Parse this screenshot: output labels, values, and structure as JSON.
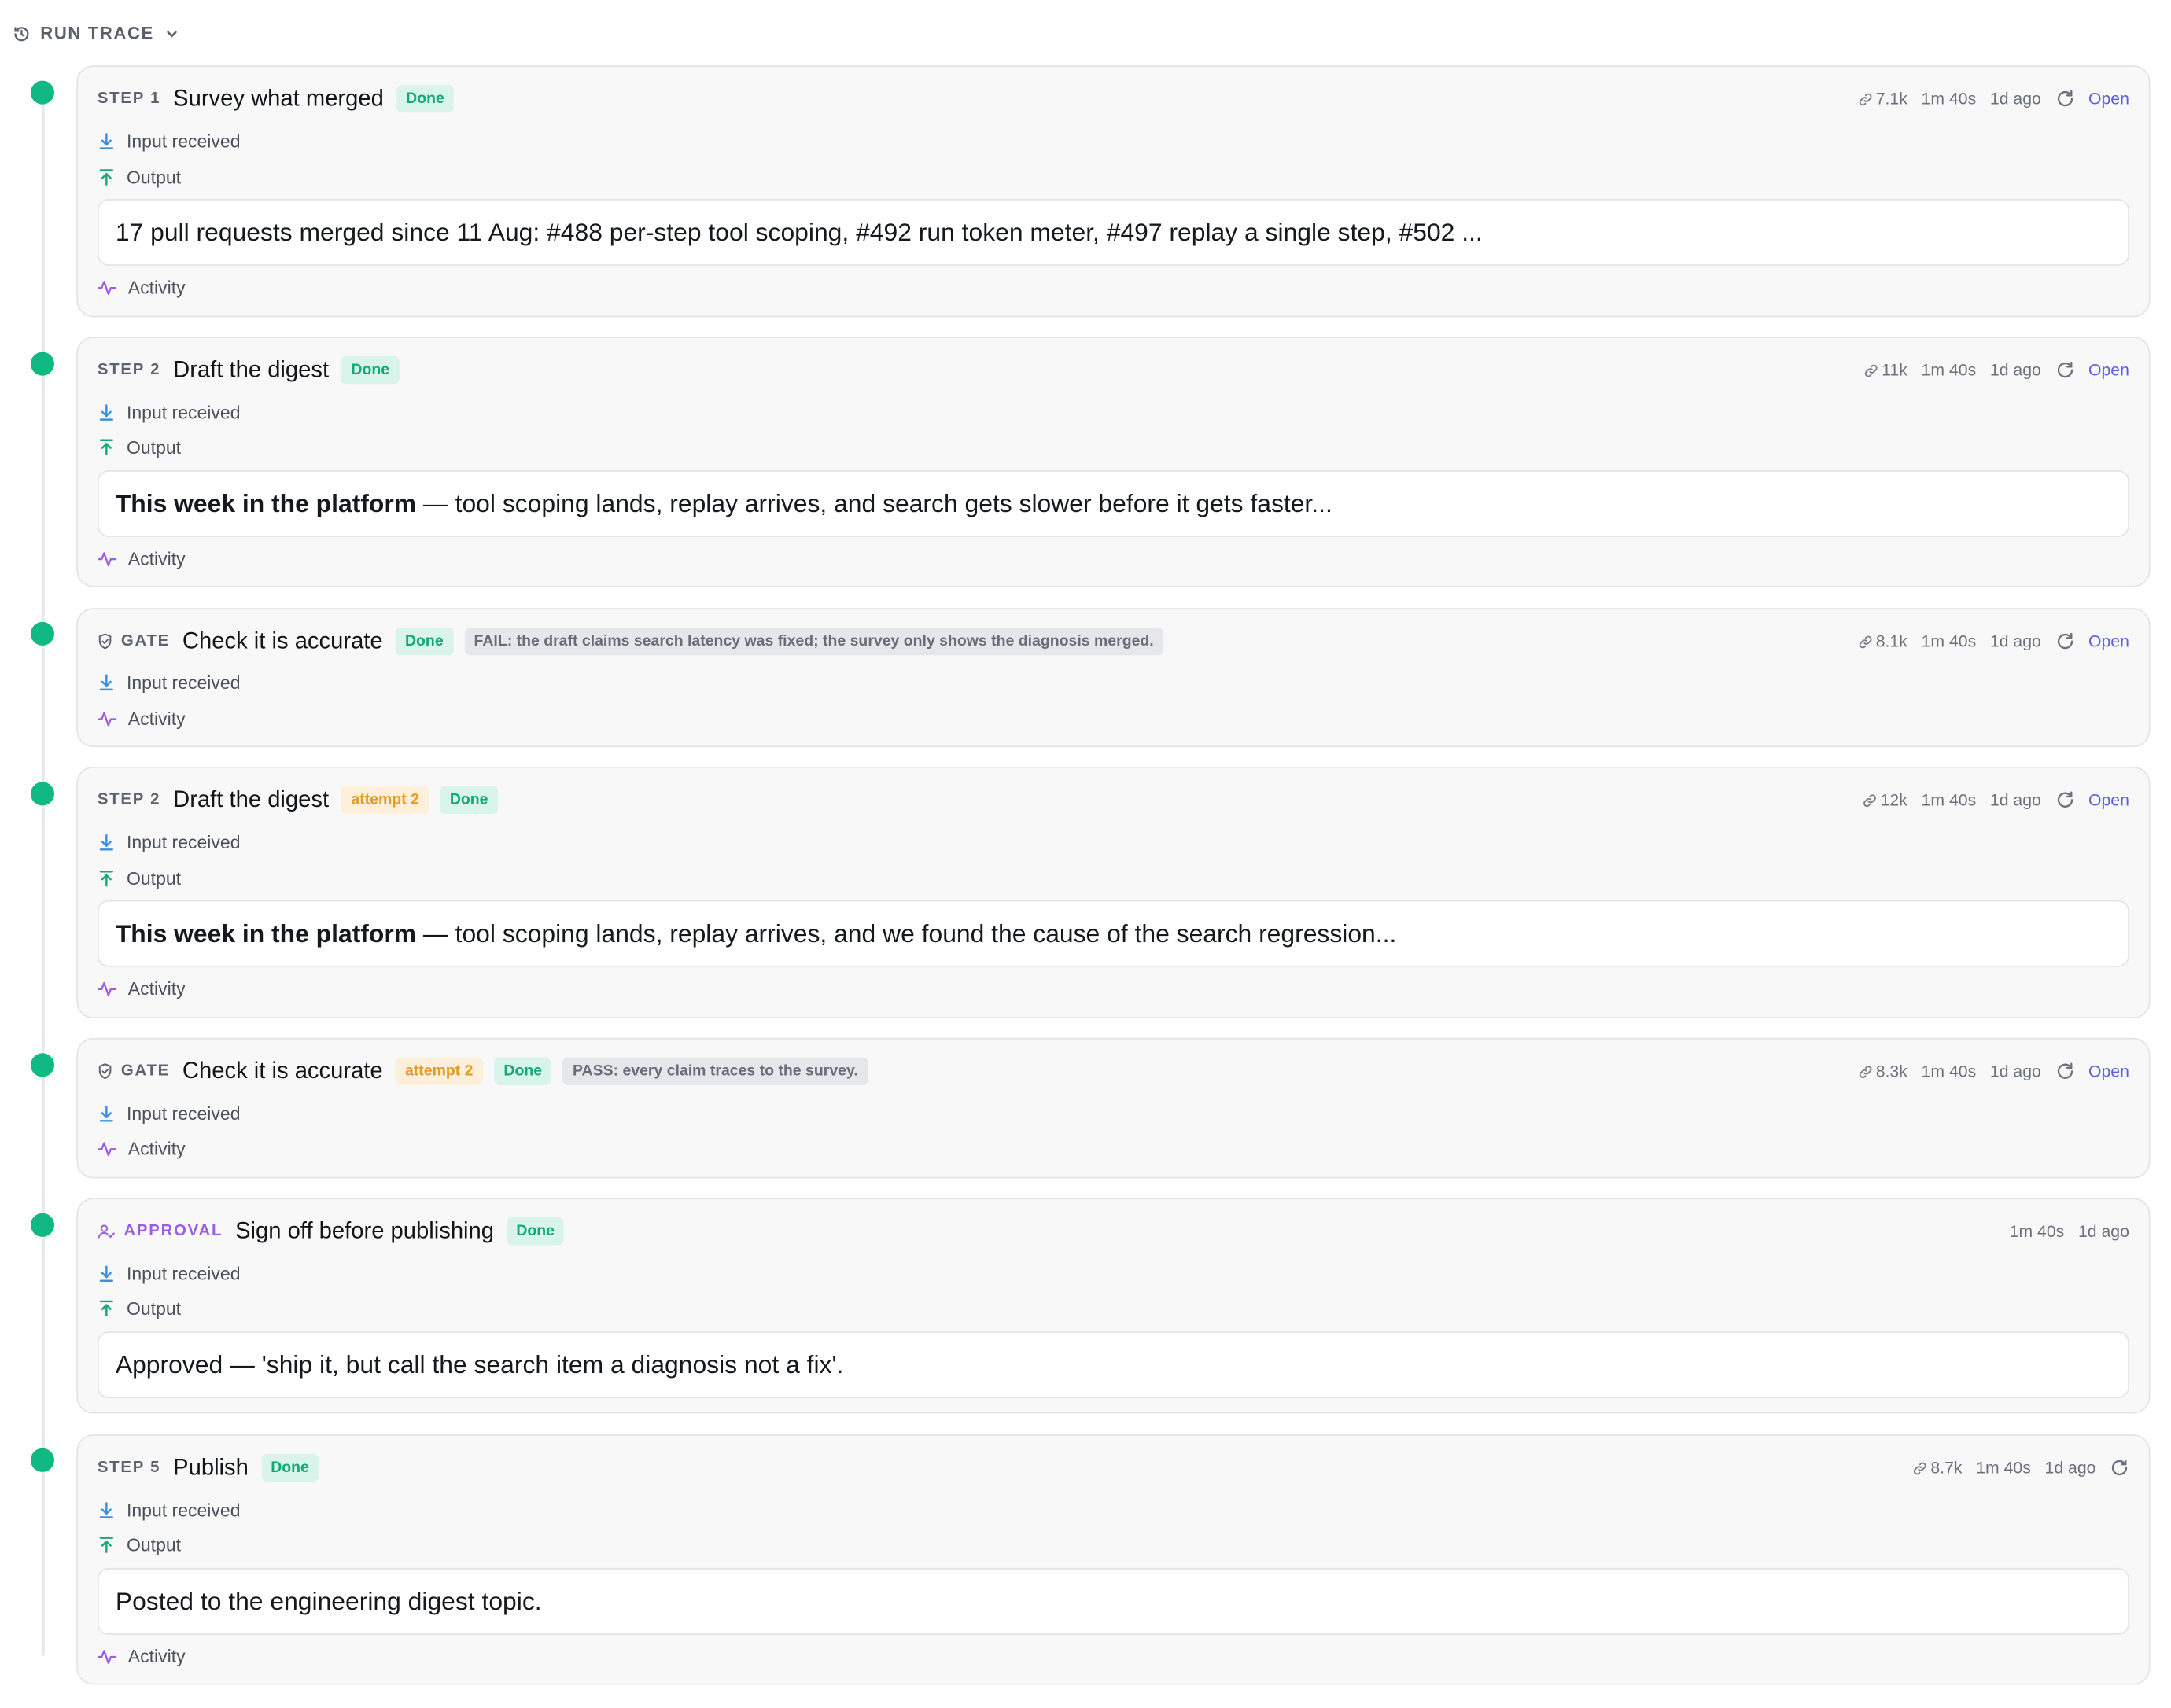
{
  "header": {
    "label": "RUN TRACE"
  },
  "labels": {
    "input": "Input received",
    "output": "Output",
    "activity": "Activity",
    "open": "Open"
  },
  "steps": [
    {
      "kind": "STEP 1",
      "title": "Survey what merged",
      "status": "Done",
      "tokens": "7.1k",
      "duration": "1m 40s",
      "age": "1d ago",
      "output_text": "17 pull requests merged since 11 Aug: #488 per-step tool scoping, #492 run token meter, #497 replay a single step, #502 ..."
    },
    {
      "kind": "STEP 2",
      "title": "Draft the digest",
      "status": "Done",
      "tokens": "11k",
      "duration": "1m 40s",
      "age": "1d ago",
      "output_bold": "This week in the platform",
      "output_text": "— tool scoping lands, replay arrives, and search gets slower before it gets faster..."
    },
    {
      "kind": "GATE",
      "title": "Check it is accurate",
      "status": "Done",
      "note": "FAIL: the draft claims search latency was fixed; the survey only shows the diagnosis merged.",
      "tokens": "8.1k",
      "duration": "1m 40s",
      "age": "1d ago"
    },
    {
      "kind": "STEP 2",
      "title": "Draft the digest",
      "attempt": "attempt 2",
      "status": "Done",
      "tokens": "12k",
      "duration": "1m 40s",
      "age": "1d ago",
      "output_bold": "This week in the platform",
      "output_text": "— tool scoping lands, replay arrives, and we found the cause of the search regression..."
    },
    {
      "kind": "GATE",
      "title": "Check it is accurate",
      "attempt": "attempt 2",
      "status": "Done",
      "note": "PASS: every claim traces to the survey.",
      "tokens": "8.3k",
      "duration": "1m 40s",
      "age": "1d ago"
    },
    {
      "kind": "APPROVAL",
      "title": "Sign off before publishing",
      "status": "Done",
      "duration": "1m 40s",
      "age": "1d ago",
      "output_text": "Approved — 'ship it, but call the search item a diagnosis not a fix'."
    },
    {
      "kind": "STEP 5",
      "title": "Publish",
      "status": "Done",
      "tokens": "8.7k",
      "duration": "1m 40s",
      "age": "1d ago",
      "output_text": "Posted to the engineering digest topic."
    }
  ]
}
